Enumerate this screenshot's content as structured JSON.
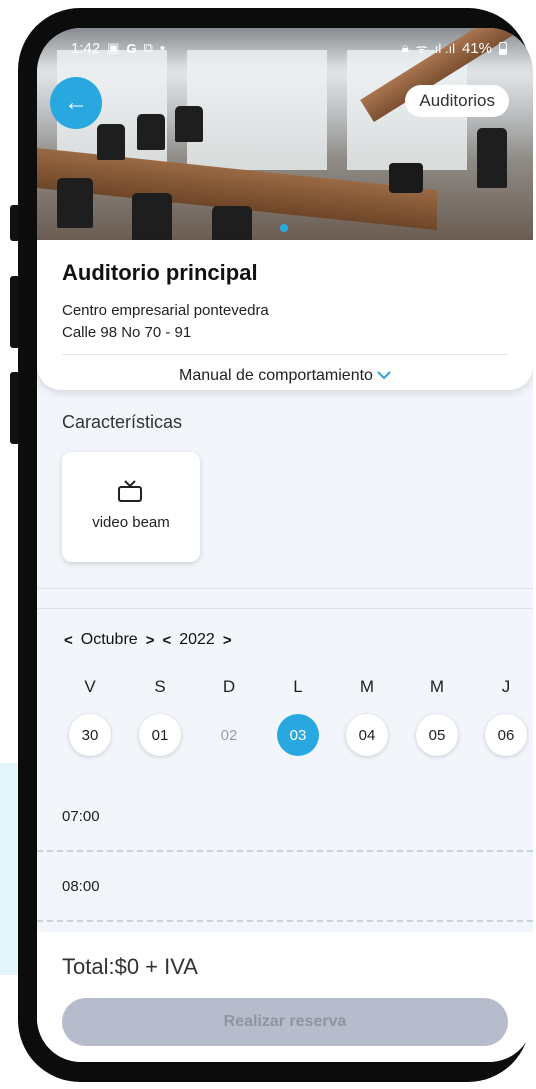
{
  "status_bar": {
    "time": "1:42",
    "left_icons": [
      "image-icon",
      "google-icon",
      "notification-icon"
    ],
    "dot": "•",
    "signal": "ᯤ .ıl .ıl",
    "battery": "41%"
  },
  "header": {
    "back_icon": "←",
    "category_tag": "Auditorios"
  },
  "venue": {
    "name": "Auditorio principal",
    "center": "Centro empresarial pontevedra",
    "address": "Calle 98 No 70 - 91",
    "manual_label": "Manual de comportamiento",
    "manual_chevron": "⌄"
  },
  "features": {
    "title": "Características",
    "items": [
      {
        "label": "video beam",
        "icon": "tv-icon"
      }
    ]
  },
  "calendar": {
    "prev": "<",
    "next": ">",
    "month": "Octubre",
    "year": "2022",
    "weekdays": [
      "V",
      "S",
      "D",
      "L",
      "M",
      "M",
      "J"
    ],
    "days": [
      "30",
      "01",
      "02",
      "03",
      "04",
      "05",
      "06"
    ],
    "selected_index": 3,
    "disabled_index": 2
  },
  "schedule": {
    "times": [
      "07:00",
      "08:00"
    ]
  },
  "footer": {
    "total": "Total:$0 + IVA",
    "reserve_label": "Realizar reserva"
  },
  "colors": {
    "accent": "#29a8e0",
    "disabled_button": "#b6bccb",
    "background": "#f2f5fa"
  }
}
